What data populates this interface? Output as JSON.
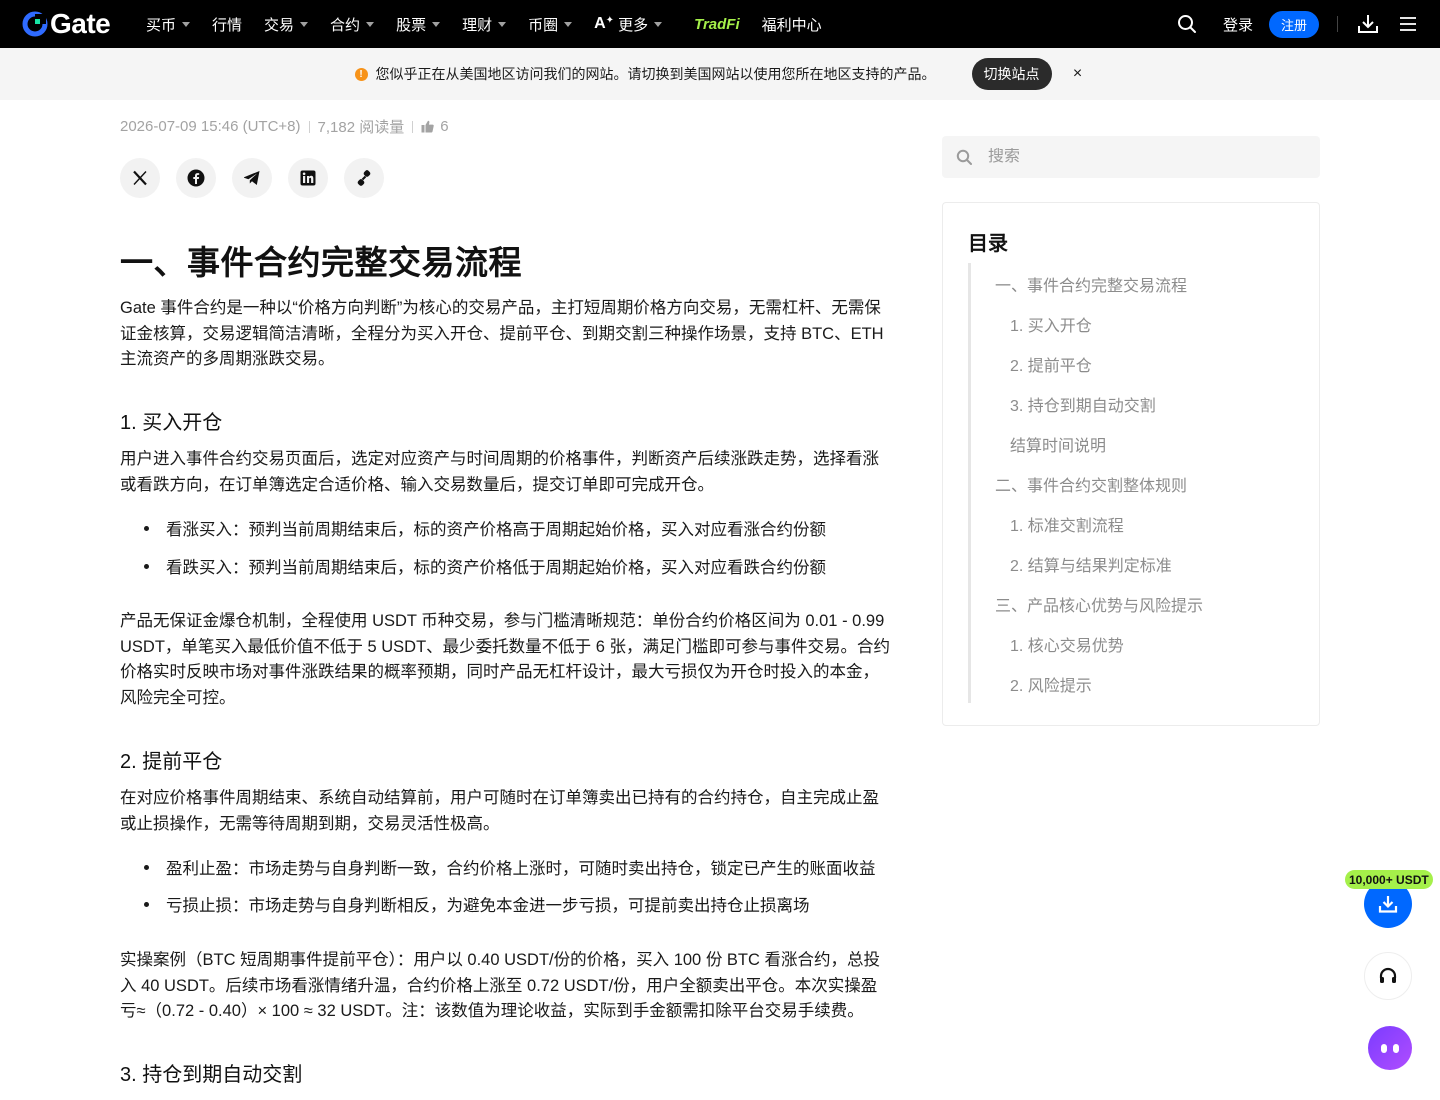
{
  "brand": {
    "name": "Gate"
  },
  "nav": {
    "items": [
      {
        "label": "买币",
        "dropdown": true
      },
      {
        "label": "行情",
        "dropdown": false
      },
      {
        "label": "交易",
        "dropdown": true
      },
      {
        "label": "合约",
        "dropdown": true
      },
      {
        "label": "股票",
        "dropdown": true
      },
      {
        "label": "理财",
        "dropdown": true
      },
      {
        "label": "币圈",
        "dropdown": true
      }
    ],
    "more_label": "更多",
    "tradfi_label": "TradFi",
    "welfare_label": "福利中心",
    "login_label": "登录",
    "signup_label": "注册"
  },
  "notice": {
    "text": "您似乎正在从美国地区访问我们的网站。请切换到美国网站以使用您所在地区支持的产品。",
    "switch_label": "切换站点",
    "close_glyph": "×"
  },
  "article": {
    "datetime": "2026-07-09 15:46 (UTC+8)",
    "views": "7,182 阅读量",
    "likes": "6",
    "h1": "一、事件合约完整交易流程",
    "intro": "Gate 事件合约是一种以“价格方向判断”为核心的交易产品，主打短周期价格方向交易，无需杠杆、无需保证金核算，交易逻辑简洁清晰，全程分为买入开仓、提前平仓、到期交割三种操作场景，支持 BTC、ETH 主流资产的多周期涨跌交易。",
    "s1_title": "1. 买入开仓",
    "s1_para": "用户进入事件合约交易页面后，选定对应资产与时间周期的价格事件，判断资产后续涨跌走势，选择看涨或看跌方向，在订单簿选定合适价格、输入交易数量后，提交订单即可完成开仓。",
    "s1_bullets": [
      "看涨买入：预判当前周期结束后，标的资产价格高于周期起始价格，买入对应看涨合约份额",
      "看跌买入：预判当前周期结束后，标的资产价格低于周期起始价格，买入对应看跌合约份额"
    ],
    "s1_para2": "产品无保证金爆仓机制，全程使用 USDT 币种交易，参与门槛清晰规范：单份合约价格区间为 0.01 - 0.99 USDT，单笔买入最低价值不低于 5 USDT、最少委托数量不低于 6 张，满足门槛即可参与事件交易。合约价格实时反映市场对事件涨跌结果的概率预期，同时产品无杠杆设计，最大亏损仅为开仓时投入的本金，风险完全可控。",
    "s2_title": "2. 提前平仓",
    "s2_para": "在对应价格事件周期结束、系统自动结算前，用户可随时在订单簿卖出已持有的合约持仓，自主完成止盈或止损操作，无需等待周期到期，交易灵活性极高。",
    "s2_bullets": [
      "盈利止盈：市场走势与自身判断一致，合约价格上涨时，可随时卖出持仓，锁定已产生的账面收益",
      "亏损止损：市场走势与自身判断相反，为避免本金进一步亏损，可提前卖出持仓止损离场"
    ],
    "s2_para2": "实操案例（BTC 短周期事件提前平仓）：用户以 0.40 USDT/份的价格，买入 100 份 BTC 看涨合约，总投入 40 USDT。后续市场看涨情绪升温，合约价格上涨至 0.72 USDT/份，用户全额卖出平仓。本次实操盈亏≈（0.72 - 0.40）× 100 ≈ 32 USDT。注：该数值为理论收益，实际到手金额需扣除平台交易手续费。",
    "s3_title": "3. 持仓到期自动交割"
  },
  "sidebar": {
    "search_placeholder": "搜索",
    "toc_title": "目录",
    "toc": [
      {
        "label": "一、事件合约完整交易流程",
        "level": 1
      },
      {
        "label": "1. 买入开仓",
        "level": 2
      },
      {
        "label": "2. 提前平仓",
        "level": 2
      },
      {
        "label": "3. 持仓到期自动交割",
        "level": 2
      },
      {
        "label": "结算时间说明",
        "level": 2
      },
      {
        "label": "二、事件合约交割整体规则",
        "level": 1
      },
      {
        "label": "1. 标准交割流程",
        "level": 2
      },
      {
        "label": "2. 结算与结果判定标准",
        "level": 2
      },
      {
        "label": "三、产品核心优势与风险提示",
        "level": 1
      },
      {
        "label": "1. 核心交易优势",
        "level": 2
      },
      {
        "label": "2. 风险提示",
        "level": 2
      }
    ]
  },
  "floating": {
    "reward_badge": "10,000+ USDT"
  },
  "colors": {
    "nav_bg": "#000000",
    "accent_blue": "#0068ff",
    "tradfi_green": "#a5f04a",
    "notice_orange": "#f7931a",
    "bot_purple": "#8a3dff"
  }
}
